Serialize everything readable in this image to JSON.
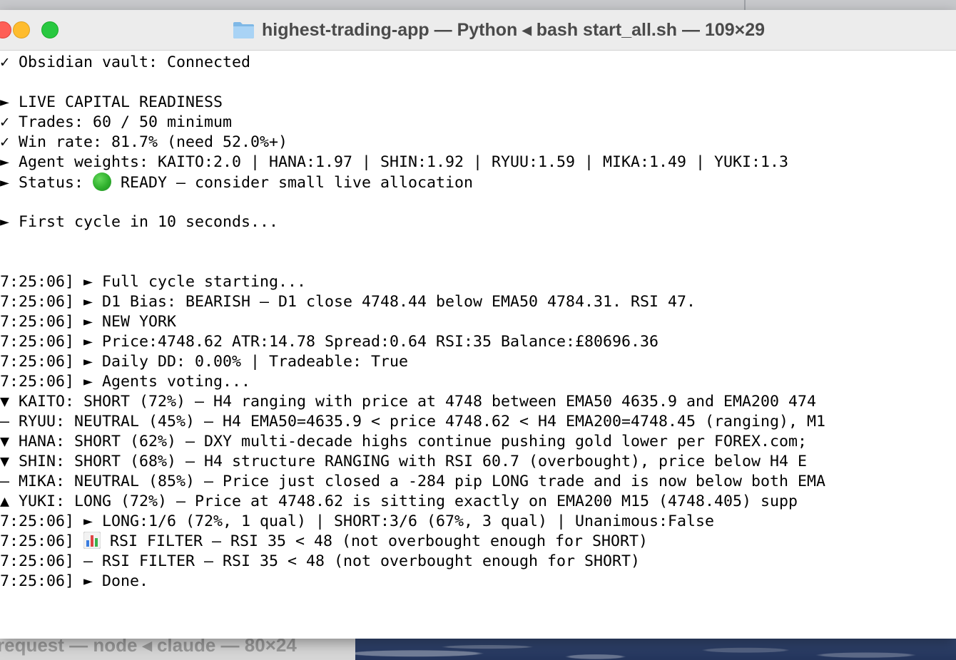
{
  "window": {
    "title": "highest-trading-app — Python ◂ bash start_all.sh — 109×29",
    "folder_icon": "folder-icon"
  },
  "background_window": {
    "title": "request — node ◂ claude — 80×24"
  },
  "colors": {
    "close": "#fe5f57",
    "minimize": "#febc2e",
    "maximize": "#28c840",
    "status_ready": "#2fb02d"
  },
  "terminal": {
    "lines": [
      "✓ Obsidian vault: Connected",
      "",
      "► LIVE CAPITAL READINESS",
      "✓ Trades: 60 / 50 minimum",
      "✓ Win rate: 81.7% (need 52.0%+)",
      "► Agent weights: KAITO:2.0 | HANA:1.97 | SHIN:1.92 | RYUU:1.59 | MIKA:1.49 | YUKI:1.3",
      "",
      "",
      "► First cycle in 10 seconds...",
      "",
      "",
      "7:25:06] ► Full cycle starting...",
      "7:25:06] ► D1 Bias: BEARISH — D1 close 4748.44 below EMA50 4784.31. RSI 47.",
      "7:25:06] ► NEW YORK",
      "7:25:06] ► Price:4748.62 ATR:14.78 Spread:0.64 RSI:35 Balance:£80696.36",
      "7:25:06] ► Daily DD: 0.00% | Tradeable: True",
      "7:25:06] ► Agents voting...",
      "▼ KAITO: SHORT (72%) — H4 ranging with price at 4748 between EMA50 4635.9 and EMA200 474",
      "— RYUU: NEUTRAL (45%) — H4 EMA50=4635.9 < price 4748.62 < H4 EMA200=4748.45 (ranging), M1",
      "▼ HANA: SHORT (62%) — DXY multi-decade highs continue pushing gold lower per FOREX.com;",
      "▼ SHIN: SHORT (68%) — H4 structure RANGING with RSI 60.7 (overbought), price below H4 E",
      "— MIKA: NEUTRAL (85%) — Price just closed a -284 pip LONG trade and is now below both EMA",
      "▲ YUKI: LONG (72%) — Price at 4748.62 is sitting exactly on EMA200 M15 (4748.405) supp",
      "7:25:06] ► LONG:1/6 (72%, 1 qual) | SHORT:3/6 (67%, 3 qual) | Unanimous:False",
      "",
      "7:25:06] — RSI FILTER — RSI 35 < 48 (not overbought enough for SHORT)",
      "7:25:06] ► Done."
    ],
    "status_line": {
      "prefix": "► Status: ",
      "icon": "green-circle-icon",
      "text": " READY — consider small live allocation"
    },
    "rsi_line": {
      "prefix": "7:25:06] ",
      "icon": "bar-chart-icon",
      "text": " RSI FILTER — RSI 35 < 48 (not overbought enough for SHORT)"
    }
  }
}
